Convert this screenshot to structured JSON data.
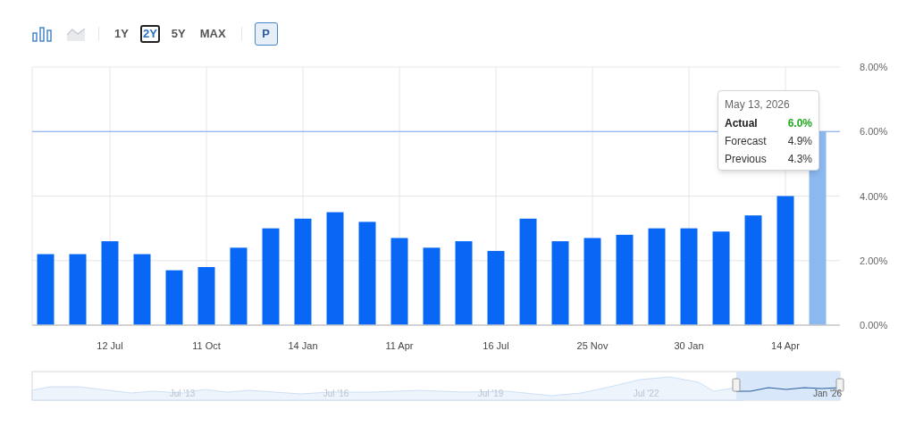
{
  "toolbar": {
    "chart_types": [
      {
        "kind": "bar",
        "selected": true
      },
      {
        "kind": "line",
        "selected": false
      }
    ],
    "ranges": [
      {
        "label": "1Y",
        "selected": false
      },
      {
        "label": "2Y",
        "selected": true
      },
      {
        "label": "5Y",
        "selected": false
      },
      {
        "label": "MAX",
        "selected": false
      }
    ],
    "preliminary_button": {
      "label": "P",
      "selected": true
    }
  },
  "chart": {
    "chart_data": {
      "type": "bar",
      "categories": [
        null,
        null,
        "12 Jul",
        null,
        null,
        "11 Oct",
        null,
        null,
        "14 Jan",
        null,
        null,
        "11 Apr",
        null,
        null,
        "16 Jul",
        null,
        null,
        "25 Nov",
        null,
        null,
        "30 Jan",
        null,
        null,
        "14 Apr",
        null
      ],
      "grid": true,
      "ref_lines": [
        {
          "value": 6,
          "axis": "y"
        }
      ],
      "values": [
        2.2,
        2.2,
        2.6,
        2.2,
        1.7,
        1.8,
        2.4,
        3.0,
        3.3,
        3.5,
        3.2,
        2.7,
        2.4,
        2.6,
        2.3,
        3.3,
        2.6,
        2.7,
        2.8,
        3.0,
        3.0,
        2.9,
        3.4,
        4.0,
        6.0
      ],
      "yticks": [
        {
          "value": 0,
          "label": "0.00%"
        },
        {
          "value": 2,
          "label": "2.00%"
        },
        {
          "value": 4,
          "label": "4.00%"
        },
        {
          "value": 6,
          "label": "6.00%"
        },
        {
          "value": 8,
          "label": "8.00%"
        }
      ],
      "ylim": [
        0,
        8
      ]
    },
    "tooltip": {
      "last_bar_hovered": true,
      "date": "May 13, 2026",
      "rows": [
        {
          "label": "Actual",
          "value": "6.0%",
          "kind": "actual"
        },
        {
          "label": "Forecast",
          "value": "4.9%",
          "kind": "plain"
        },
        {
          "label": "Previous",
          "value": "4.3%",
          "kind": "plain"
        }
      ]
    }
  },
  "navigator": {
    "labels": [
      "Jul '13",
      "Jul '16",
      "Jul '19",
      "Jul '22",
      "Jan '26"
    ]
  }
}
